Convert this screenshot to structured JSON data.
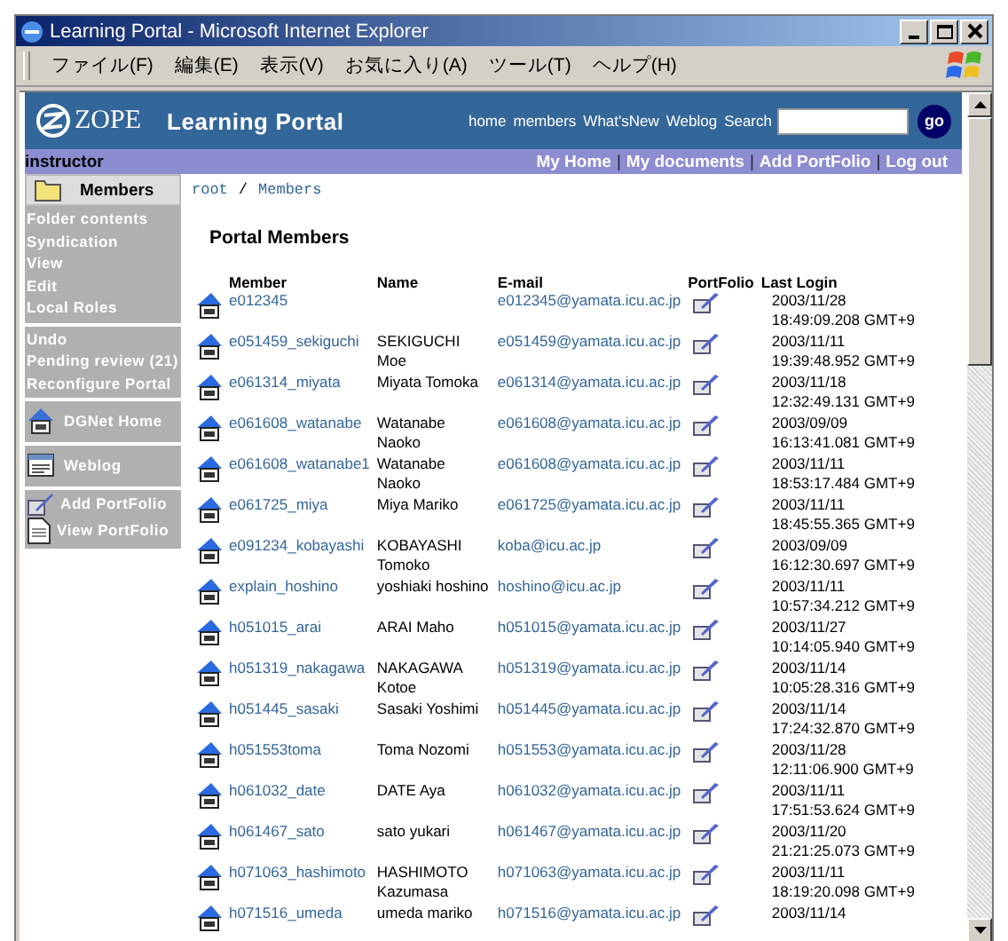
{
  "window": {
    "title": "Learning Portal - Microsoft Internet Explorer"
  },
  "menu": [
    "ファイル(F)",
    "編集(E)",
    "表示(V)",
    "お気に入り(A)",
    "ツール(T)",
    "ヘルプ(H)"
  ],
  "header": {
    "logo": "ZOPE",
    "site_title": "Learning Portal",
    "nav": [
      "home",
      "members",
      "What'sNew",
      "Weblog",
      "Search"
    ],
    "go": "go"
  },
  "user_bar": {
    "user": "instructor",
    "links": [
      "My Home",
      "My documents",
      "Add PortFolio",
      "Log out"
    ],
    "separator": "|"
  },
  "sidebar": {
    "title": "Members",
    "groups": [
      {
        "kind": "text",
        "items": [
          "Folder contents",
          "Syndication",
          "View",
          "Edit",
          "Local Roles"
        ]
      },
      {
        "kind": "text",
        "items": [
          "Undo",
          "Pending review (21)",
          "Reconfigure Portal"
        ]
      },
      {
        "kind": "home",
        "items": [
          "DGNet Home"
        ]
      },
      {
        "kind": "weblog",
        "items": [
          "Weblog"
        ]
      },
      {
        "kind": "portfolio",
        "items": [
          "Add PortFolio",
          "View PortFolio"
        ]
      }
    ]
  },
  "breadcrumb": {
    "items": [
      "root",
      "Members"
    ],
    "separator": "/"
  },
  "heading": "Portal Members",
  "table": {
    "columns": [
      "Member",
      "Name",
      "E-mail",
      "PortFolio",
      "Last Login"
    ],
    "rows": [
      {
        "member": "e012345",
        "email": "e012345@yamata.icu.ac.jp",
        "date": "2003/11/28",
        "time": "18:49:09.208 GMT+9"
      },
      {
        "member": "e051459_sekiguchi",
        "name": "SEKIGUCHI Moe",
        "email": "e051459@yamata.icu.ac.jp",
        "date": "2003/11/11",
        "time": "19:39:48.952 GMT+9"
      },
      {
        "member": "e061314_miyata",
        "name": "Miyata Tomoka",
        "email": "e061314@yamata.icu.ac.jp",
        "date": "2003/11/18",
        "time": "12:32:49.131 GMT+9"
      },
      {
        "member": "e061608_watanabe",
        "name": "Watanabe Naoko",
        "email": "e061608@yamata.icu.ac.jp",
        "date": "2003/09/09",
        "time": "16:13:41.081 GMT+9"
      },
      {
        "member": "e061608_watanabe1",
        "name": "Watanabe Naoko",
        "email": "e061608@yamata.icu.ac.jp",
        "date": "2003/11/11",
        "time": "18:53:17.484 GMT+9"
      },
      {
        "member": "e061725_miya",
        "name": "Miya Mariko",
        "email": "e061725@yamata.icu.ac.jp",
        "date": "2003/11/11",
        "time": "18:45:55.365 GMT+9"
      },
      {
        "member": "e091234_kobayashi",
        "name": "KOBAYASHI Tomoko",
        "email": "koba@icu.ac.jp",
        "date": "2003/09/09",
        "time": "16:12:30.697 GMT+9"
      },
      {
        "member": "explain_hoshino",
        "name": "yoshiaki hoshino",
        "email": "hoshino@icu.ac.jp",
        "date": "2003/11/11",
        "time": "10:57:34.212 GMT+9"
      },
      {
        "member": "h051015_arai",
        "name": "ARAI Maho",
        "email": "h051015@yamata.icu.ac.jp",
        "date": "2003/11/27",
        "time": "10:14:05.940 GMT+9"
      },
      {
        "member": "h051319_nakagawa",
        "name": "NAKAGAWA Kotoe",
        "email": "h051319@yamata.icu.ac.jp",
        "date": "2003/11/14",
        "time": "10:05:28.316 GMT+9"
      },
      {
        "member": "h051445_sasaki",
        "name": "Sasaki Yoshimi",
        "email": "h051445@yamata.icu.ac.jp",
        "date": "2003/11/14",
        "time": "17:24:32.870 GMT+9"
      },
      {
        "member": "h051553toma",
        "name": "Toma Nozomi",
        "email": "h051553@yamata.icu.ac.jp",
        "date": "2003/11/28",
        "time": "12:11:06.900 GMT+9"
      },
      {
        "member": "h061032_date",
        "name": "DATE Aya",
        "email": "h061032@yamata.icu.ac.jp",
        "date": "2003/11/11",
        "time": "17:51:53.624 GMT+9"
      },
      {
        "member": "h061467_sato",
        "name": "sato yukari",
        "email": "h061467@yamata.icu.ac.jp",
        "date": "2003/11/20",
        "time": "21:21:25.073 GMT+9"
      },
      {
        "member": "h071063_hashimoto",
        "name": "HASHIMOTO Kazumasa",
        "email": "h071063@yamata.icu.ac.jp",
        "date": "2003/11/11",
        "time": "18:19:20.098 GMT+9"
      },
      {
        "member": "h071516_umeda",
        "name": "umeda mariko",
        "email": "h071516@yamata.icu.ac.jp",
        "date": "2003/11/14"
      }
    ]
  }
}
